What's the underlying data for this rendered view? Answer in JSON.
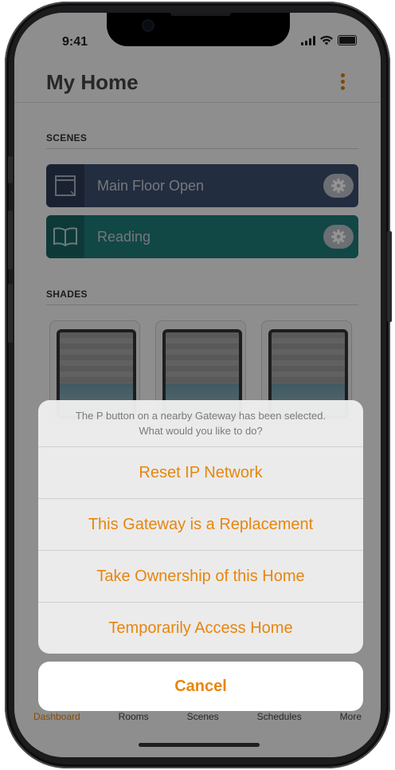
{
  "status": {
    "time": "9:41"
  },
  "header": {
    "title": "My Home"
  },
  "scenes": {
    "section_label": "SCENES",
    "items": [
      {
        "label": "Main Floor Open",
        "color": "#3d4f6e"
      },
      {
        "label": "Reading",
        "color": "#1e7a78"
      }
    ]
  },
  "shades": {
    "section_label": "SHADES"
  },
  "tabs": [
    {
      "label": "Dashboard",
      "active": true
    },
    {
      "label": "Rooms"
    },
    {
      "label": "Scenes"
    },
    {
      "label": "Schedules"
    },
    {
      "label": "More"
    }
  ],
  "action_sheet": {
    "message_line1": "The P button on a nearby Gateway has been selected.",
    "message_line2": "What would you like to do?",
    "actions": [
      {
        "label": "Reset IP Network"
      },
      {
        "label": "This Gateway is a Replacement"
      },
      {
        "label": "Take Ownership of this Home"
      },
      {
        "label": "Temporarily Access Home"
      }
    ],
    "cancel_label": "Cancel"
  },
  "colors": {
    "accent": "#e7860d"
  }
}
